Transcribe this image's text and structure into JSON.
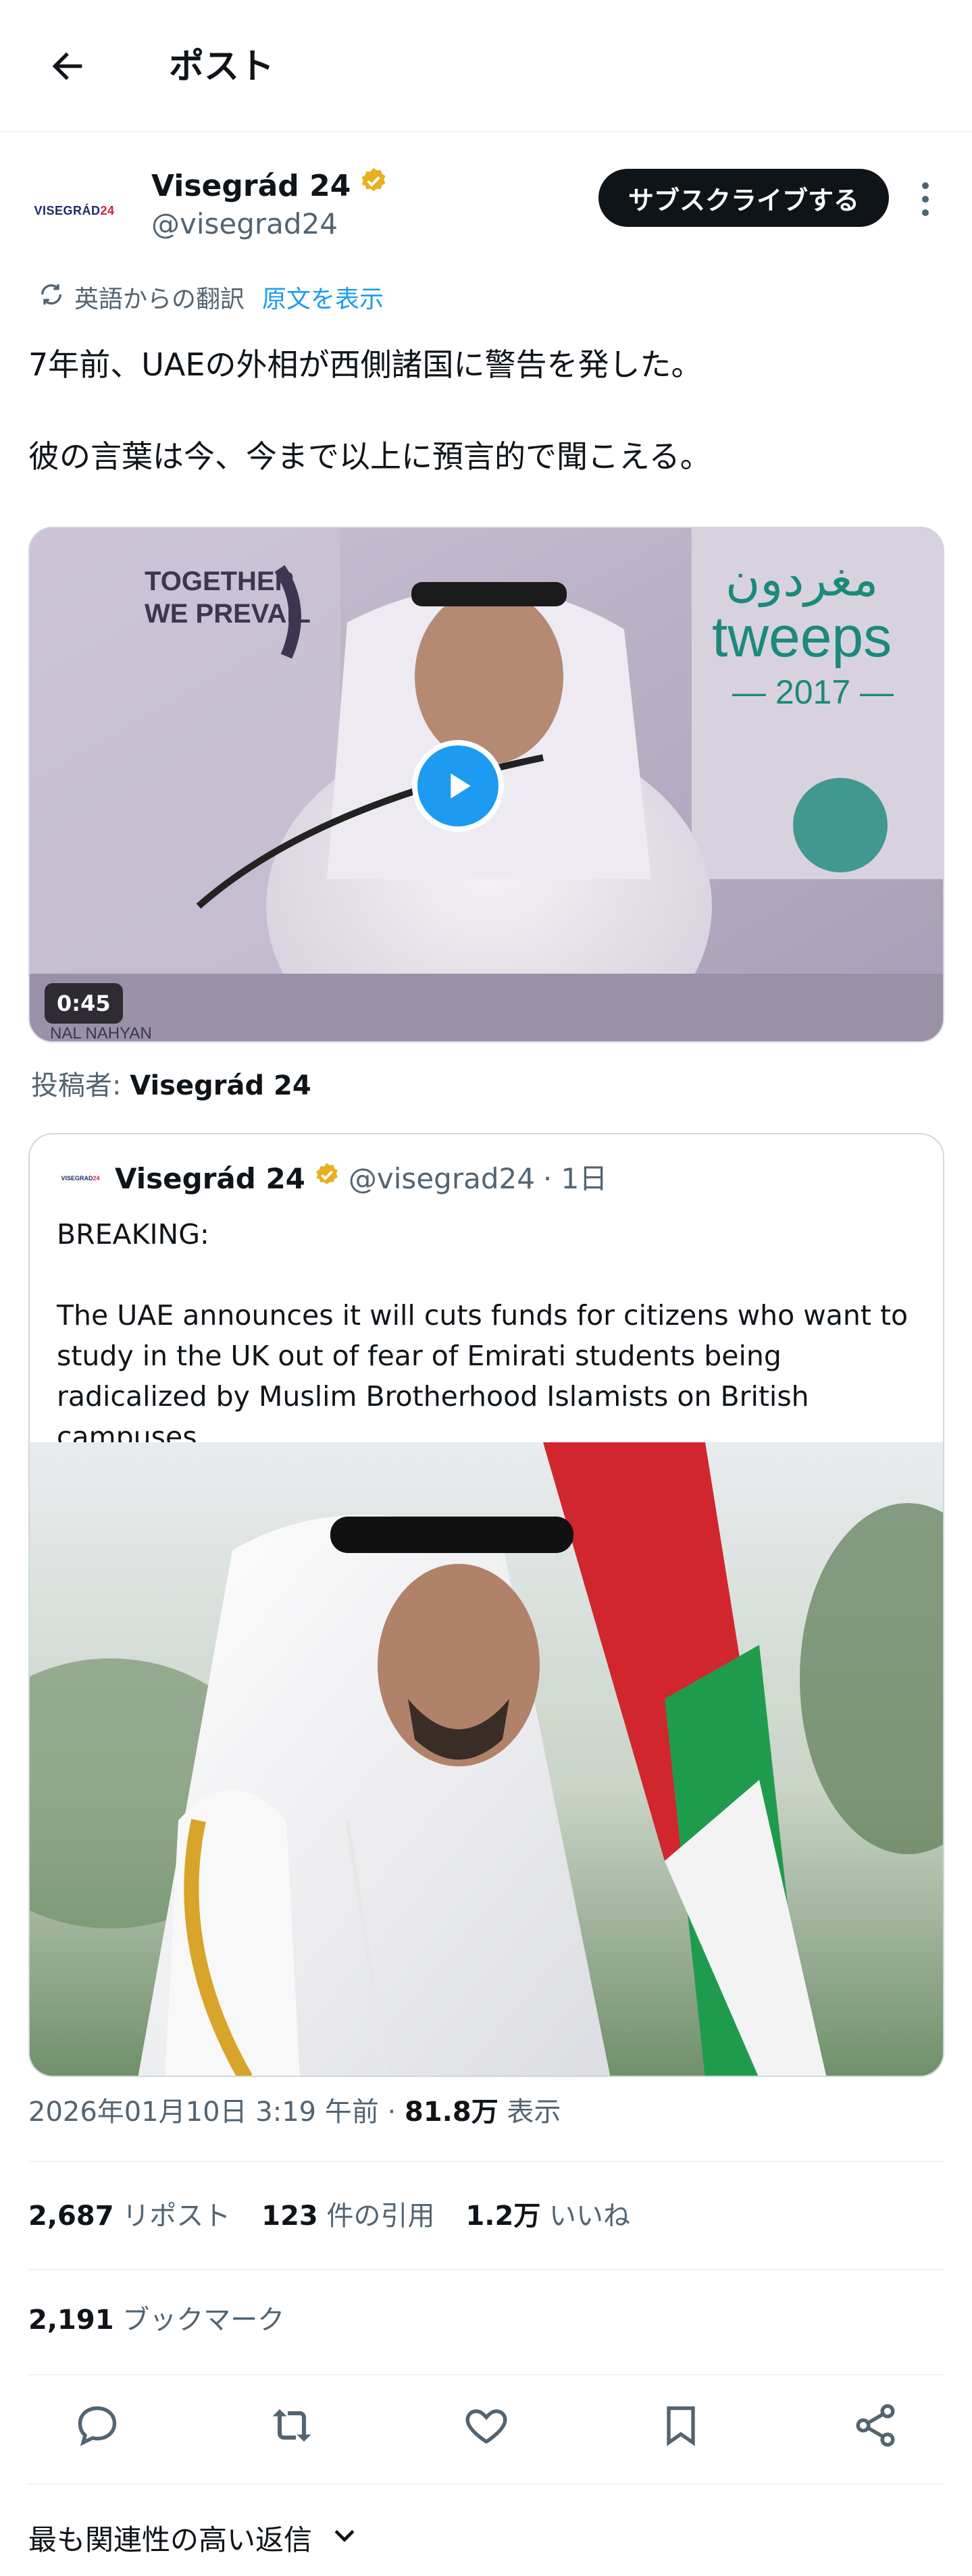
{
  "header": {
    "title": "ポスト"
  },
  "author": {
    "avatar_text_a": "VISEGRÁD",
    "avatar_text_b": "24",
    "name": "Visegrád 24",
    "handle": "@visegrad24",
    "subscribe_label": "サブスクライブする"
  },
  "translation": {
    "label": "英語からの翻訳",
    "show_original": "原文を表示"
  },
  "post": {
    "line1": "7年前、UAEの外相が西側諸国に警告を発した。",
    "line2": "彼の言葉は今、今まで以上に預言的で聞こえる。"
  },
  "video": {
    "duration": "0:45",
    "sign_text1": "TOGETHER",
    "sign_text2": "WE PREVAIL",
    "sign_text3": "tweeps",
    "sign_text4": "— 2017 —",
    "sign_text5": "مغردون",
    "sign_text6": "NAL NAHYAN"
  },
  "posted_by": {
    "label": "投稿者:",
    "name": "Visegrád 24"
  },
  "quote": {
    "avatar_a": "VISEGRAD",
    "avatar_b": "24",
    "name": "Visegrád 24",
    "handle": "@visegrad24",
    "time": "· 1日",
    "line1": "BREAKING:",
    "line2": "The UAE announces it will cuts funds for citizens who want to study in the UK out of fear of Emirati students being radicalized by Muslim Brotherhood Islamists on British campuses...."
  },
  "meta": {
    "datetime": "2026年01月10日 3:19 午前 · ",
    "views": "81.8万",
    "views_label": "表示"
  },
  "stats": {
    "reposts": "2,687",
    "reposts_label": "リポスト",
    "quotes": "123",
    "quotes_label": "件の引用",
    "likes": "1.2万",
    "likes_label": "いいね"
  },
  "bookmarks": {
    "count": "2,191",
    "label": "ブックマーク"
  },
  "replies": {
    "sort_label": "最も関連性の高い返信"
  },
  "colors": {
    "accent": "#1d9bf0",
    "verified": "#e8b020",
    "text": "#0f1419",
    "muted": "#536471"
  }
}
